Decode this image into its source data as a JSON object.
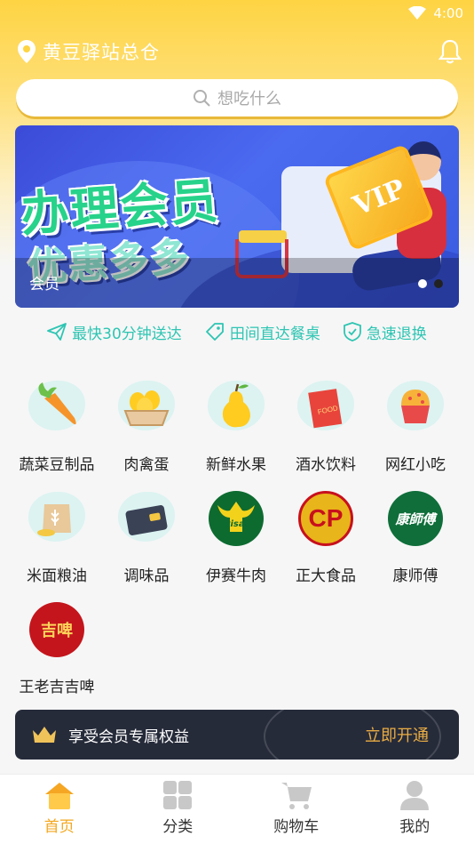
{
  "status_bar": {
    "time": "4:00"
  },
  "header": {
    "location": "黄豆驿站总仓"
  },
  "search": {
    "placeholder": "想吃什么"
  },
  "banner": {
    "headline": "办理会员",
    "subline": "优惠多多",
    "vip_text": "VIP",
    "caption": "会员",
    "slide_count": 2,
    "active_slide": 2
  },
  "features": [
    {
      "icon": "paper-plane-icon",
      "label": "最快30分钟送达"
    },
    {
      "icon": "tag-icon",
      "label": "田间直达餐桌"
    },
    {
      "icon": "shield-check-icon",
      "label": "急速退换"
    }
  ],
  "categories": [
    {
      "label": "蔬菜豆制品",
      "icon": "carrot-icon"
    },
    {
      "label": "肉禽蛋",
      "icon": "eggs-icon"
    },
    {
      "label": "新鲜水果",
      "icon": "pear-icon"
    },
    {
      "label": "酒水饮料",
      "icon": "snack-bag-icon",
      "icon_text": "FOOD"
    },
    {
      "label": "网红小吃",
      "icon": "cupcake-icon"
    },
    {
      "label": "米面粮油",
      "icon": "grain-sack-icon"
    },
    {
      "label": "调味品",
      "icon": "wallet-icon"
    },
    {
      "label": "伊赛牛肉",
      "icon": "yisai-logo",
      "logo_text": "yisai"
    },
    {
      "label": "正大食品",
      "icon": "cp-logo",
      "logo_text": "CP"
    },
    {
      "label": "康师傅",
      "icon": "kangshifu-logo",
      "logo_text": "康師傅"
    },
    {
      "label": "王老吉吉啤",
      "icon": "jipi-logo",
      "logo_text": "吉啤"
    }
  ],
  "vip_bar": {
    "text": "享受会员专属权益",
    "action": "立即开通"
  },
  "tabbar": [
    {
      "label": "首页",
      "icon": "home-icon",
      "active": true
    },
    {
      "label": "分类",
      "icon": "category-grid-icon",
      "active": false
    },
    {
      "label": "购物车",
      "icon": "cart-icon",
      "active": false
    },
    {
      "label": "我的",
      "icon": "user-icon",
      "active": false
    }
  ],
  "colors": {
    "header_yellow": "#fed443",
    "accent_teal": "#2ec5b3",
    "tab_active": "#f3a71e",
    "vip_bar_bg": "#262b3a",
    "vip_action": "#e9ac43"
  }
}
